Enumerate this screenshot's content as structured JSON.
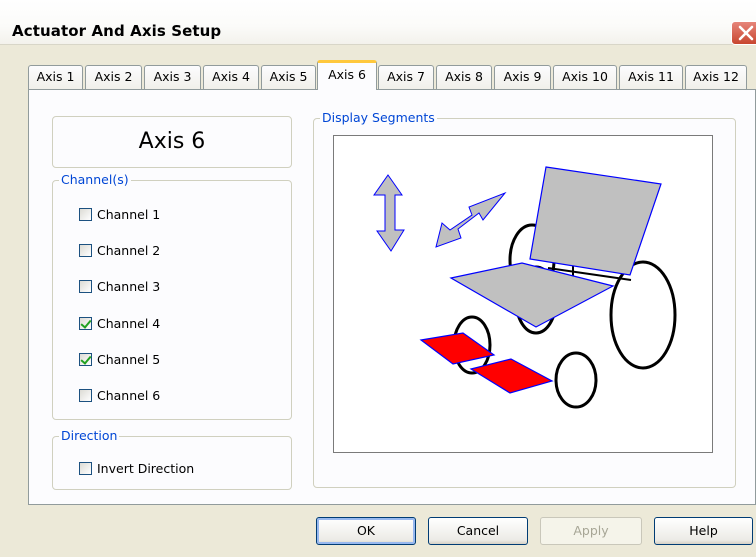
{
  "window": {
    "title": "Actuator And Axis Setup"
  },
  "tabs": [
    {
      "label": "Axis 1"
    },
    {
      "label": "Axis 2"
    },
    {
      "label": "Axis 3"
    },
    {
      "label": "Axis 4"
    },
    {
      "label": "Axis 5"
    },
    {
      "label": "Axis 6",
      "selected": true
    },
    {
      "label": "Axis 7"
    },
    {
      "label": "Axis 8"
    },
    {
      "label": "Axis 9"
    },
    {
      "label": "Axis 10"
    },
    {
      "label": "Axis 11"
    },
    {
      "label": "Axis 12"
    }
  ],
  "axis_name": "Axis 6",
  "channels": {
    "legend": "Channel(s)",
    "items": [
      {
        "label": "Channel 1",
        "checked": false
      },
      {
        "label": "Channel 2",
        "checked": false
      },
      {
        "label": "Channel 3",
        "checked": false
      },
      {
        "label": "Channel 4",
        "checked": true
      },
      {
        "label": "Channel 5",
        "checked": true
      },
      {
        "label": "Channel 6",
        "checked": false
      }
    ]
  },
  "direction": {
    "legend": "Direction",
    "invert_label": "Invert Direction",
    "invert_checked": false
  },
  "display": {
    "legend": "Display Segments"
  },
  "colors": {
    "accent_legend": "#0046d5",
    "active_tab": "#ffc83c",
    "segment_selected": "#ff0000",
    "segment_default": "#c0c0c0",
    "segment_outline": "#0000ff"
  },
  "buttons": {
    "ok": "OK",
    "cancel": "Cancel",
    "apply": "Apply",
    "help": "Help"
  }
}
